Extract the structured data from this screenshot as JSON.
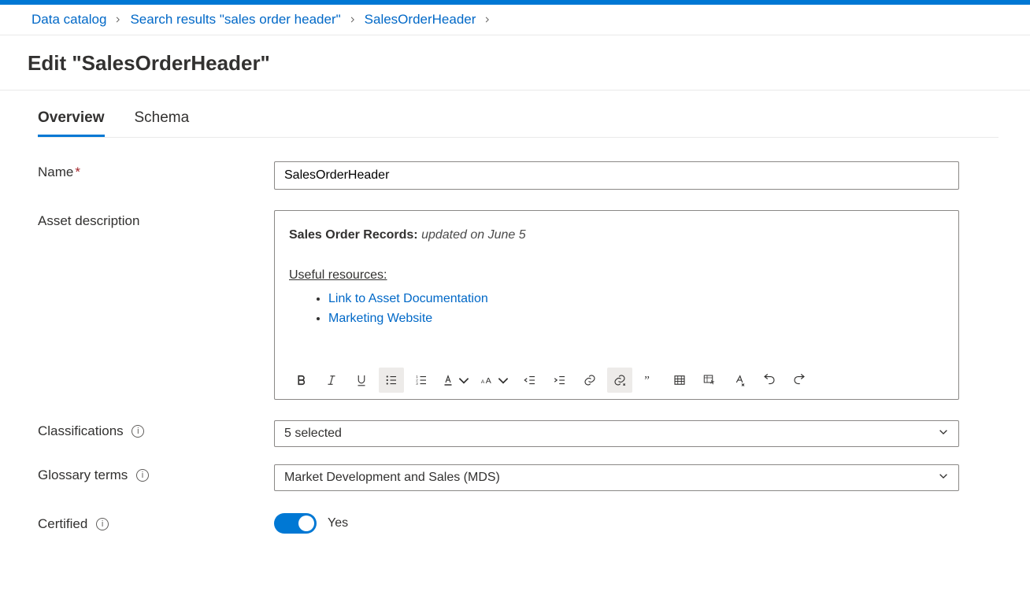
{
  "breadcrumb": {
    "items": [
      {
        "label": "Data catalog"
      },
      {
        "label": "Search results \"sales order header\""
      },
      {
        "label": "SalesOrderHeader"
      }
    ]
  },
  "page_title": "Edit \"SalesOrderHeader\"",
  "tabs": {
    "overview": "Overview",
    "schema": "Schema"
  },
  "labels": {
    "name": "Name",
    "asset_description": "Asset description",
    "classifications": "Classifications",
    "glossary_terms": "Glossary terms",
    "certified": "Certified"
  },
  "fields": {
    "name_value": "SalesOrderHeader",
    "description": {
      "title_bold": "Sales Order Records: ",
      "title_italic": "updated on June 5",
      "resources_heading": "Useful resources:",
      "links": [
        "Link to Asset Documentation",
        "Marketing Website"
      ]
    },
    "classifications_display": "5 selected",
    "glossary_display": "Market Development and Sales (MDS)",
    "certified_on": true,
    "certified_label": "Yes"
  }
}
